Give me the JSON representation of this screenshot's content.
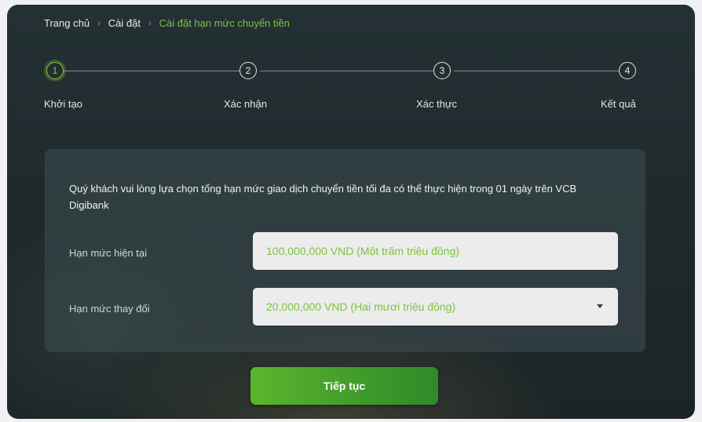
{
  "breadcrumb": {
    "home": "Trang chủ",
    "settings": "Cài đặt",
    "current": "Cài đặt hạn mức chuyển tiền"
  },
  "steps": [
    {
      "number": "1",
      "label": "Khởi tạo",
      "active": true
    },
    {
      "number": "2",
      "label": "Xác nhận",
      "active": false
    },
    {
      "number": "3",
      "label": "Xác thực",
      "active": false
    },
    {
      "number": "4",
      "label": "Kết quả",
      "active": false
    }
  ],
  "form": {
    "instruction": "Quý khách vui lòng lựa chọn tổng hạn mức giao dịch chuyển tiền tối đa có thể thực hiện trong 01 ngày trên VCB Digibank",
    "current_limit_label": "Hạn mức hiện tại",
    "current_limit_value": "100,000,000 VND (Một trăm triệu đồng)",
    "new_limit_label": "Hạn mức thay đổi",
    "new_limit_value": "20,000,000 VND (Hai mươi triệu đồng)"
  },
  "actions": {
    "continue_label": "Tiếp tục"
  },
  "colors": {
    "accent": "#7cc43c",
    "button": "#4aa52c",
    "background": "#222d30"
  }
}
